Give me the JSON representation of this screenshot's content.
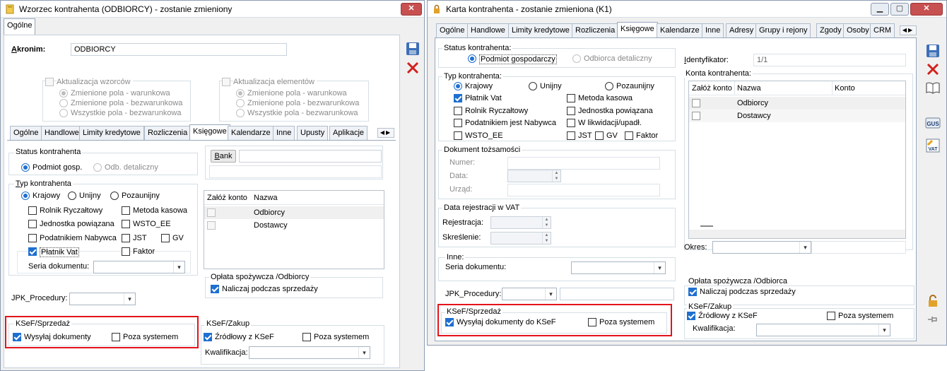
{
  "left": {
    "title": "Wzorzec kontrahenta (ODBIORCY) - zostanie zmieniony",
    "top_tab": "Ogólne",
    "akronim_label": "Akronim:",
    "akronim_value": "ODBIORCY",
    "akt_wzorcow": "Aktualizacja wzorców",
    "akt_elementow": "Aktualizacja elementów",
    "opt1": "Zmienione pola - warunkowa",
    "opt2": "Zmienione pola - bezwarunkowa",
    "opt3": "Wszystkie pola - bezwarunkowa",
    "tabs": [
      "Ogólne",
      "Handlowe",
      "Limity kredytowe",
      "Rozliczenia",
      "Księgowe",
      "Kalendarze",
      "Inne",
      "Upusty",
      "Aplikacje"
    ],
    "status_title": "Status kontrahenta",
    "status_pg": "Podmiot gosp.",
    "status_od": "Odb. detaliczny",
    "typ_title": "Typ kontrahenta",
    "krajowy": "Krajowy",
    "unijny": "Unijny",
    "pozaunijny": "Pozaunijny",
    "rolnik": "Rolnik Ryczałtowy",
    "metoda": "Metoda kasowa",
    "jednostka": "Jednostka powiązana",
    "wsto": "WSTO_EE",
    "podatnikiem": "Podatnikiem Nabywca",
    "jst": "JST",
    "gv": "GV",
    "platnik": "Płatnik Vat",
    "faktor": "Faktor",
    "seria": "Seria dokumentu:",
    "jpk": "JPK_Procedury:",
    "bank": "Bank",
    "grid_h1": "Załóż konto",
    "grid_h2": "Nazwa",
    "grid_rows": [
      "Odbiorcy",
      "Dostawcy"
    ],
    "oplata": "Opłata spożywcza /Odbiorcy",
    "naliczaj": "Naliczaj podczas sprzedaży",
    "ksef_sp": "KSeF/Sprzedaż",
    "wysylaj": "Wysyłaj dokumenty",
    "poza": "Poza systemem",
    "ksef_zak": "KSeF/Zakup",
    "zrodlowy": "Źródłowy z KSeF",
    "kwalifikacja": "Kwalifikacja:"
  },
  "right": {
    "title": "Karta kontrahenta - zostanie zmieniona (K1)",
    "tabs": [
      "Ogólne",
      "Handlowe",
      "Limity kredytowe",
      "Rozliczenia",
      "Księgowe",
      "Kalendarze",
      "Inne",
      "Adresy",
      "Grupy i rejony",
      "Zgody",
      "Osoby",
      "CRM"
    ],
    "status_title": "Status kontrahenta:",
    "status_pg": "Podmiot gospodarczy",
    "status_od": "Odbiorca detaliczny",
    "identyfikator": "Identyfikator:",
    "ident_value": "1/1",
    "typ_title": "Typ kontrahenta:",
    "krajowy": "Krajowy",
    "unijny": "Unijny",
    "pozaunijny": "Pozaunijny",
    "platnik": "Płatnik Vat",
    "metoda": "Metoda kasowa",
    "rolnik": "Rolnik Ryczałtowy",
    "jednostka": "Jednostka powiązana",
    "podatnikiem": "Podatnikiem jest Nabywca",
    "likwidacji": "W likwidacji/upadł.",
    "wsto": "WSTO_EE",
    "jst": "JST",
    "gv": "GV",
    "faktor": "Faktor",
    "konta_title": "Konta kontrahenta:",
    "grid_h1": "Załóż konto",
    "grid_h2": "Nazwa",
    "grid_h3": "Konto",
    "grid_rows": [
      "Odbiorcy",
      "Dostawcy"
    ],
    "okres": "Okres:",
    "dok_title": "Dokument tożsamości",
    "numer": "Numer:",
    "data": "Data:",
    "urzad": "Urząd:",
    "rej_title": "Data rejestracji w VAT",
    "rejestracja": "Rejestracja:",
    "skreslenie": "Skreślenie:",
    "inne": "Inne:",
    "seria": "Seria dokumentu:",
    "jpk": "JPK_Procedury:",
    "oplata": "Opłata spożywcza /Odbiorca",
    "naliczaj": "Naliczaj podczas sprzedaży",
    "ksef_sp": "KSeF/Sprzedaż",
    "wysylaj": "Wysyłaj dokumenty do KSeF",
    "poza": "Poza systemem",
    "ksef_zak": "KSeF/Zakup",
    "zrodlowy": "Źródłowy z KSeF",
    "poza2": "Poza systemem",
    "kwalifikacja": "Kwalifikacja:"
  },
  "icons": {
    "save": "save-icon",
    "cancel": "close-icon",
    "book": "book-icon",
    "gus": "gus-icon",
    "vat": "vat-icon",
    "lock": "lock-icon",
    "pin": "pin-icon"
  },
  "colors": {
    "accent": "#1e6fd0",
    "highlight": "#e3141b",
    "close": "#c75050"
  }
}
